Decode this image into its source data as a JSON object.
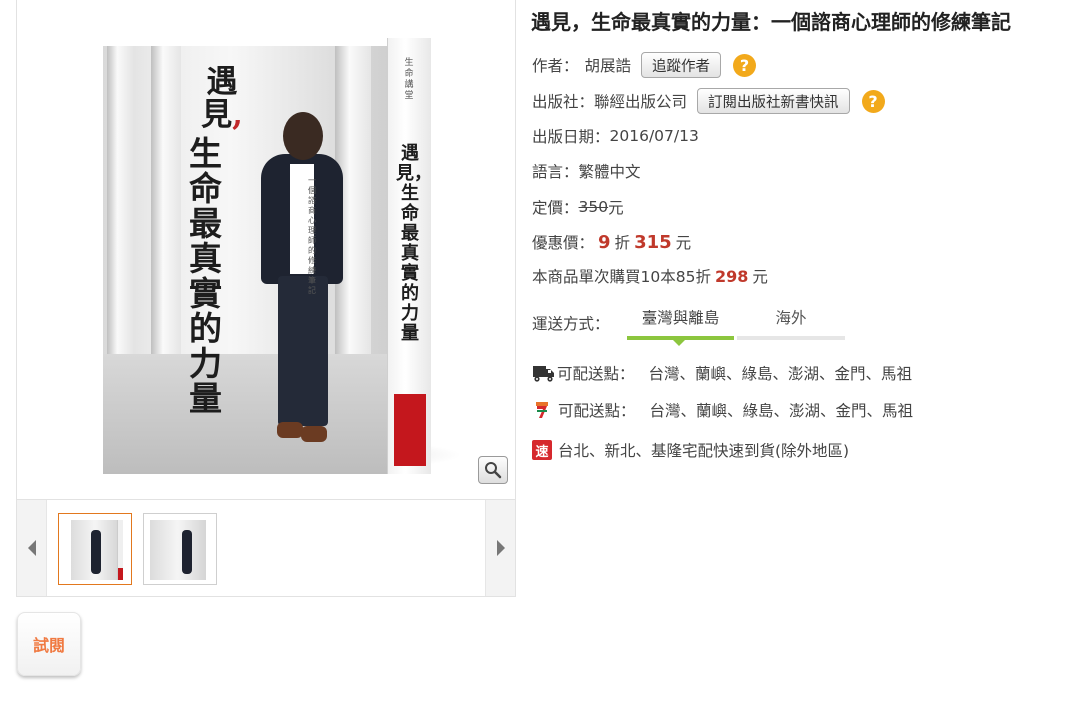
{
  "book": {
    "title": "遇見，生命最真實的力量：一個諮商心理師的修練筆記",
    "cover": {
      "title_line1": "遇見",
      "title_line2": "生命最真實的力量",
      "subtitle": "一個諮商心理師的修練筆記",
      "spine_title": "遇見，生命最真實的力量",
      "series": "生命講堂"
    }
  },
  "info": {
    "author_label": "作者：",
    "author": "胡展誥",
    "follow_author": "追蹤作者",
    "publisher_label": "出版社：",
    "publisher": "聯經出版公司",
    "subscribe_publisher": "訂閱出版社新書快訊",
    "date_label": "出版日期：",
    "date": "2016/07/13",
    "lang_label": "語言：",
    "lang": "繁體中文",
    "list_price_label": "定價：",
    "list_price": "350",
    "list_price_unit": "元",
    "sale_label": "優惠價：",
    "discount": "9",
    "discount_unit": "折",
    "sale_price": "315",
    "sale_unit": "元",
    "bulk_text": "本商品單次購買10本85折",
    "bulk_price": "298",
    "bulk_unit": "元"
  },
  "shipping": {
    "label": "運送方式：",
    "tabs": [
      "臺灣與離島",
      "海外"
    ],
    "rows": [
      {
        "label": "可配送點：",
        "places": "台灣、蘭嶼、綠島、澎湖、金門、馬祖"
      },
      {
        "label": "可配送點：",
        "places": "台灣、蘭嶼、綠島、澎湖、金門、馬祖"
      },
      {
        "badge": "速",
        "text": "台北、新北、基隆宅配快速到貨(除外地區)"
      }
    ]
  },
  "preview_button": "試閱",
  "colors": {
    "accent_orange": "#e2781e",
    "price_red": "#c0392b",
    "tab_green": "#8cc63e",
    "help_yellow": "#f2a91b"
  }
}
